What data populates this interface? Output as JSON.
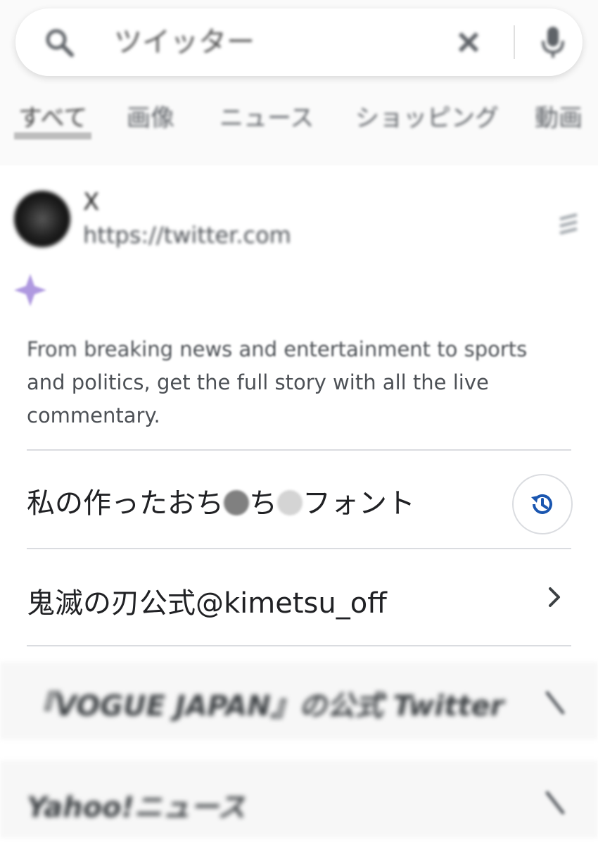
{
  "search": {
    "query": "ツイッター"
  },
  "tabs": [
    {
      "label": "すべて",
      "active": true
    },
    {
      "label": "画像",
      "active": false
    },
    {
      "label": "ニュース",
      "active": false
    },
    {
      "label": "ショッピング",
      "active": false
    },
    {
      "label": "動画",
      "active": false
    }
  ],
  "result": {
    "site_name": "X",
    "url": "https://twitter.com",
    "snippet_line1": "From breaking news and entertainment to sports",
    "snippet_line2": "and politics, get the full story with all the live",
    "snippet_line3": "commentary."
  },
  "suggestions": [
    {
      "text_a": "私の作ったおち",
      "text_b": "ち",
      "text_c": "フォント",
      "icon": "history-icon"
    },
    {
      "text": "鬼滅の刃公式@kimetsu_off",
      "icon": "chevron-right-icon"
    },
    {
      "text": "『VOGUE JAPAN』の公式 Twitter",
      "icon": "chevron-right-icon"
    },
    {
      "text": "Yahoo!ニュース",
      "icon": "chevron-right-icon"
    }
  ],
  "colors": {
    "accent": "#1a56b0",
    "gemini": "#9b7fd8",
    "divider": "#dadce0"
  }
}
